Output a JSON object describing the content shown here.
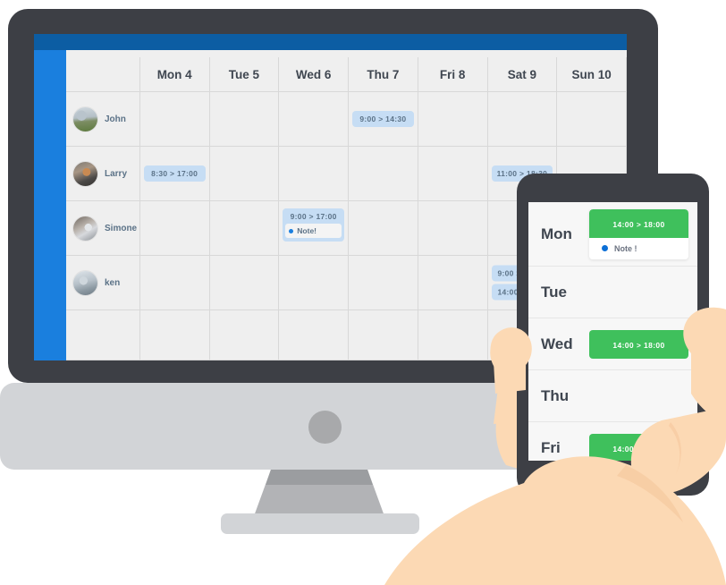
{
  "scene": {
    "title": "Responsive scheduling app mockup on desktop monitor and smartphone",
    "monitor_frame_color": "#3d3f45",
    "monitor_body_color": "#d2d4d7",
    "phone_frame_color": "#3d3f45",
    "skin_color": "#fcd9b4"
  },
  "desktop": {
    "app": {
      "topbar_color": "#0c5da3",
      "sidebar_color": "#1a7fde",
      "screen_bg": "#efefef",
      "event_color": "#c6ddf4",
      "event_text_color": "#5b7287"
    },
    "calendar": {
      "person_column_header": "",
      "day_headers": [
        "Mon 4",
        "Tue 5",
        "Wed 6",
        "Thu 7",
        "Fri 8",
        "Sat 9",
        "Sun 10"
      ],
      "rows": [
        {
          "person": "John",
          "avatar": "avatar-photo-john",
          "cells": [
            {
              "events": []
            },
            {
              "events": []
            },
            {
              "events": []
            },
            {
              "events": [
                {
                  "time": "9:00  >  14:30"
                }
              ]
            },
            {
              "events": []
            },
            {
              "events": []
            },
            {
              "events": []
            }
          ]
        },
        {
          "person": "Larry",
          "avatar": "avatar-photo-larry",
          "cells": [
            {
              "events": [
                {
                  "time": "8:30  >  17:00"
                }
              ]
            },
            {
              "events": []
            },
            {
              "events": []
            },
            {
              "events": []
            },
            {
              "events": []
            },
            {
              "events": [
                {
                  "time": "11:00  >  18:30"
                }
              ]
            },
            {
              "events": []
            }
          ]
        },
        {
          "person": "Simone",
          "avatar": "avatar-photo-simone",
          "cells": [
            {
              "events": []
            },
            {
              "events": []
            },
            {
              "events": [
                {
                  "time": "9:00  >  17:00",
                  "note": "Note!"
                }
              ]
            },
            {
              "events": []
            },
            {
              "events": []
            },
            {
              "events": []
            },
            {
              "events": []
            }
          ]
        },
        {
          "person": "ken",
          "avatar": "avatar-photo-ken",
          "cells": [
            {
              "events": []
            },
            {
              "events": []
            },
            {
              "events": []
            },
            {
              "events": []
            },
            {
              "events": []
            },
            {
              "events": [
                {
                  "time": "9:00  >  1"
                },
                {
                  "time": "14:00  >  1"
                }
              ]
            },
            {
              "events": []
            }
          ]
        },
        {
          "person": "",
          "avatar": "",
          "cells": [
            {
              "events": []
            },
            {
              "events": []
            },
            {
              "events": []
            },
            {
              "events": []
            },
            {
              "events": []
            },
            {
              "events": []
            },
            {
              "events": []
            }
          ]
        }
      ]
    }
  },
  "phone": {
    "chip_color": "#3fc05c",
    "chip_text_color": "#ffffff",
    "note_dot_color": "#0b6fd6",
    "rows": [
      {
        "day": "Mon",
        "chip": "14:00  >  18:00",
        "note": "Note !"
      },
      {
        "day": "Tue",
        "chip": "",
        "note": ""
      },
      {
        "day": "Wed",
        "chip": "14:00  >  18:00",
        "note": ""
      },
      {
        "day": "Thu",
        "chip": "",
        "note": ""
      },
      {
        "day": "Fri",
        "chip": "14:00  >  18:00",
        "note": ""
      }
    ]
  }
}
